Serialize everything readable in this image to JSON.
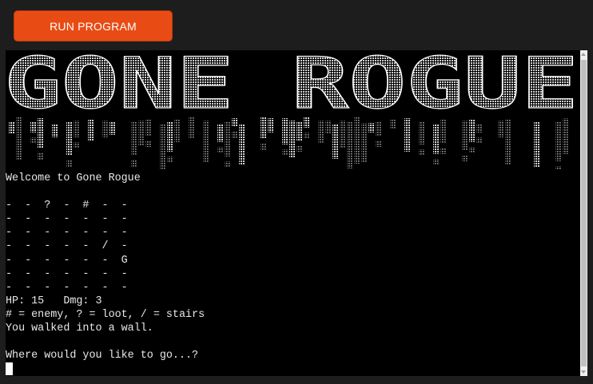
{
  "button": {
    "label": "RUN PROGRAM"
  },
  "banner": {
    "text": "GONE ROGUE"
  },
  "terminal": {
    "lines": [
      "Welcome to Gone Rogue",
      "",
      "-  -  ?  -  #  -  -",
      "-  -  -  -  -  -  -",
      "-  -  -  -  -  -  -",
      "-  -  -  -  -  /  -",
      "-  -  -  -  -  -  G",
      "-  -  -  -  -  -  -",
      "-  -  -  -  -  -  -",
      "HP: 15   Dmg: 3",
      "# = enemy, ? = loot, / = stairs",
      "You walked into a wall.",
      "",
      "Where would you like to go...?"
    ]
  }
}
